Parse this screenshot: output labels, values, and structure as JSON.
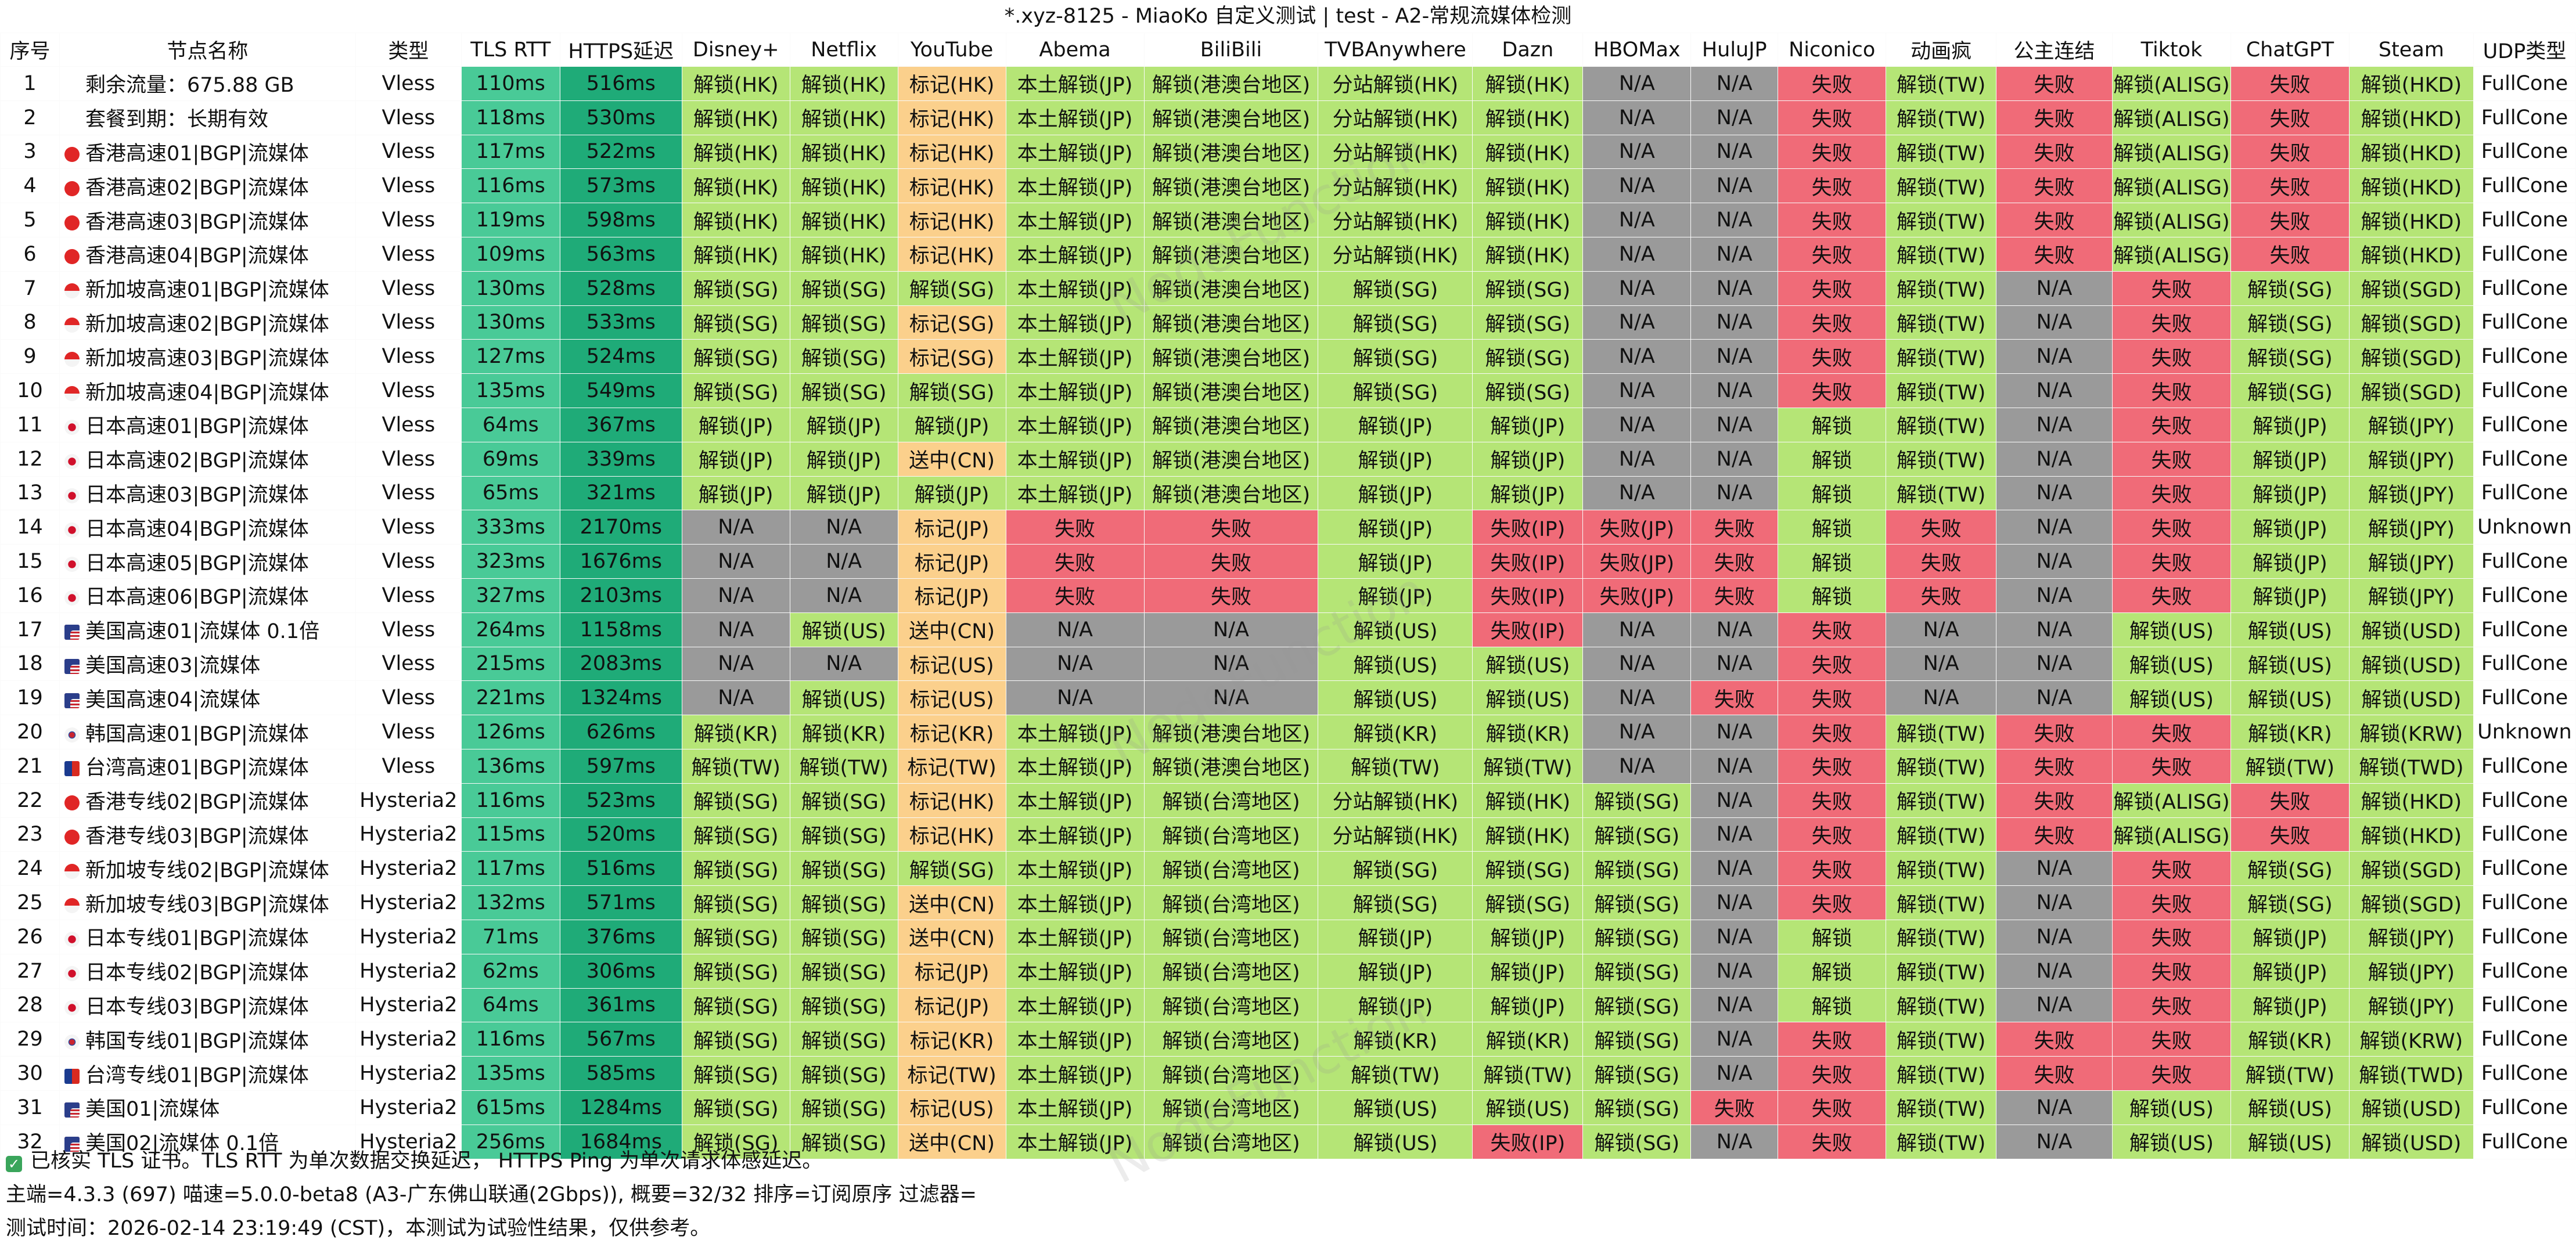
{
  "window": {
    "title": "*.xyz-8125 - MiaoKo 自定义测试 | test - A2-常规流媒体检测"
  },
  "colors": {
    "green": "#b5e576",
    "red": "#f06b78",
    "gray": "#9a9a9a",
    "orange": "#fbd08c",
    "white": "#ffffff",
    "rtt": "#49ca97",
    "https": "#1fab78"
  },
  "table": {
    "columns": [
      "序号",
      "节点名称",
      "类型",
      "TLS RTT",
      "HTTPS延迟",
      "Disney+",
      "Netflix",
      "YouTube",
      "Abema",
      "BiliBili",
      "TVBAnywhere",
      "Dazn",
      "HBOMax",
      "HuluJP",
      "Niconico",
      "动画疯",
      "公主连结",
      "Tiktok",
      "ChatGPT",
      "Steam",
      "UDP类型"
    ],
    "rows": [
      {
        "id": "1",
        "flag": "",
        "name": "剩余流量：675.88 GB",
        "type": "Vless",
        "rtt": "110ms",
        "https": "516ms",
        "cells": [
          "解锁(HK)",
          "解锁(HK)",
          "标记(HK)",
          "本土解锁(JP)",
          "解锁(港澳台地区)",
          "分站解锁(HK)",
          "解锁(HK)",
          "N/A",
          "N/A",
          "失败",
          "解锁(TW)",
          "失败",
          "解锁(ALISG)",
          "失败",
          "解锁(HKD)",
          "FullCone"
        ]
      },
      {
        "id": "2",
        "flag": "",
        "name": "套餐到期：长期有效",
        "type": "Vless",
        "rtt": "118ms",
        "https": "530ms",
        "cells": [
          "解锁(HK)",
          "解锁(HK)",
          "标记(HK)",
          "本土解锁(JP)",
          "解锁(港澳台地区)",
          "分站解锁(HK)",
          "解锁(HK)",
          "N/A",
          "N/A",
          "失败",
          "解锁(TW)",
          "失败",
          "解锁(ALISG)",
          "失败",
          "解锁(HKD)",
          "FullCone"
        ]
      },
      {
        "id": "3",
        "flag": "hk",
        "name": "香港高速01|BGP|流媒体",
        "type": "Vless",
        "rtt": "117ms",
        "https": "522ms",
        "cells": [
          "解锁(HK)",
          "解锁(HK)",
          "标记(HK)",
          "本土解锁(JP)",
          "解锁(港澳台地区)",
          "分站解锁(HK)",
          "解锁(HK)",
          "N/A",
          "N/A",
          "失败",
          "解锁(TW)",
          "失败",
          "解锁(ALISG)",
          "失败",
          "解锁(HKD)",
          "FullCone"
        ]
      },
      {
        "id": "4",
        "flag": "hk",
        "name": "香港高速02|BGP|流媒体",
        "type": "Vless",
        "rtt": "116ms",
        "https": "573ms",
        "cells": [
          "解锁(HK)",
          "解锁(HK)",
          "标记(HK)",
          "本土解锁(JP)",
          "解锁(港澳台地区)",
          "分站解锁(HK)",
          "解锁(HK)",
          "N/A",
          "N/A",
          "失败",
          "解锁(TW)",
          "失败",
          "解锁(ALISG)",
          "失败",
          "解锁(HKD)",
          "FullCone"
        ]
      },
      {
        "id": "5",
        "flag": "hk",
        "name": "香港高速03|BGP|流媒体",
        "type": "Vless",
        "rtt": "119ms",
        "https": "598ms",
        "cells": [
          "解锁(HK)",
          "解锁(HK)",
          "标记(HK)",
          "本土解锁(JP)",
          "解锁(港澳台地区)",
          "分站解锁(HK)",
          "解锁(HK)",
          "N/A",
          "N/A",
          "失败",
          "解锁(TW)",
          "失败",
          "解锁(ALISG)",
          "失败",
          "解锁(HKD)",
          "FullCone"
        ]
      },
      {
        "id": "6",
        "flag": "hk",
        "name": "香港高速04|BGP|流媒体",
        "type": "Vless",
        "rtt": "109ms",
        "https": "563ms",
        "cells": [
          "解锁(HK)",
          "解锁(HK)",
          "标记(HK)",
          "本土解锁(JP)",
          "解锁(港澳台地区)",
          "分站解锁(HK)",
          "解锁(HK)",
          "N/A",
          "N/A",
          "失败",
          "解锁(TW)",
          "失败",
          "解锁(ALISG)",
          "失败",
          "解锁(HKD)",
          "FullCone"
        ]
      },
      {
        "id": "7",
        "flag": "sg",
        "name": "新加坡高速01|BGP|流媒体",
        "type": "Vless",
        "rtt": "130ms",
        "https": "528ms",
        "cells": [
          "解锁(SG)",
          "解锁(SG)",
          "解锁(SG)",
          "本土解锁(JP)",
          "解锁(港澳台地区)",
          "解锁(SG)",
          "解锁(SG)",
          "N/A",
          "N/A",
          "失败",
          "解锁(TW)",
          "N/A",
          "失败",
          "解锁(SG)",
          "解锁(SGD)",
          "FullCone"
        ]
      },
      {
        "id": "8",
        "flag": "sg",
        "name": "新加坡高速02|BGP|流媒体",
        "type": "Vless",
        "rtt": "130ms",
        "https": "533ms",
        "cells": [
          "解锁(SG)",
          "解锁(SG)",
          "标记(SG)",
          "本土解锁(JP)",
          "解锁(港澳台地区)",
          "解锁(SG)",
          "解锁(SG)",
          "N/A",
          "N/A",
          "失败",
          "解锁(TW)",
          "N/A",
          "失败",
          "解锁(SG)",
          "解锁(SGD)",
          "FullCone"
        ]
      },
      {
        "id": "9",
        "flag": "sg",
        "name": "新加坡高速03|BGP|流媒体",
        "type": "Vless",
        "rtt": "127ms",
        "https": "524ms",
        "cells": [
          "解锁(SG)",
          "解锁(SG)",
          "标记(SG)",
          "本土解锁(JP)",
          "解锁(港澳台地区)",
          "解锁(SG)",
          "解锁(SG)",
          "N/A",
          "N/A",
          "失败",
          "解锁(TW)",
          "N/A",
          "失败",
          "解锁(SG)",
          "解锁(SGD)",
          "FullCone"
        ]
      },
      {
        "id": "10",
        "flag": "sg",
        "name": "新加坡高速04|BGP|流媒体",
        "type": "Vless",
        "rtt": "135ms",
        "https": "549ms",
        "cells": [
          "解锁(SG)",
          "解锁(SG)",
          "解锁(SG)",
          "本土解锁(JP)",
          "解锁(港澳台地区)",
          "解锁(SG)",
          "解锁(SG)",
          "N/A",
          "N/A",
          "失败",
          "解锁(TW)",
          "N/A",
          "失败",
          "解锁(SG)",
          "解锁(SGD)",
          "FullCone"
        ]
      },
      {
        "id": "11",
        "flag": "jp",
        "name": "日本高速01|BGP|流媒体",
        "type": "Vless",
        "rtt": "64ms",
        "https": "367ms",
        "cells": [
          "解锁(JP)",
          "解锁(JP)",
          "解锁(JP)",
          "本土解锁(JP)",
          "解锁(港澳台地区)",
          "解锁(JP)",
          "解锁(JP)",
          "N/A",
          "N/A",
          "解锁",
          "解锁(TW)",
          "N/A",
          "失败",
          "解锁(JP)",
          "解锁(JPY)",
          "FullCone"
        ]
      },
      {
        "id": "12",
        "flag": "jp",
        "name": "日本高速02|BGP|流媒体",
        "type": "Vless",
        "rtt": "69ms",
        "https": "339ms",
        "cells": [
          "解锁(JP)",
          "解锁(JP)",
          "送中(CN)",
          "本土解锁(JP)",
          "解锁(港澳台地区)",
          "解锁(JP)",
          "解锁(JP)",
          "N/A",
          "N/A",
          "解锁",
          "解锁(TW)",
          "N/A",
          "失败",
          "解锁(JP)",
          "解锁(JPY)",
          "FullCone"
        ]
      },
      {
        "id": "13",
        "flag": "jp",
        "name": "日本高速03|BGP|流媒体",
        "type": "Vless",
        "rtt": "65ms",
        "https": "321ms",
        "cells": [
          "解锁(JP)",
          "解锁(JP)",
          "解锁(JP)",
          "本土解锁(JP)",
          "解锁(港澳台地区)",
          "解锁(JP)",
          "解锁(JP)",
          "N/A",
          "N/A",
          "解锁",
          "解锁(TW)",
          "N/A",
          "失败",
          "解锁(JP)",
          "解锁(JPY)",
          "FullCone"
        ]
      },
      {
        "id": "14",
        "flag": "jp",
        "name": "日本高速04|BGP|流媒体",
        "type": "Vless",
        "rtt": "333ms",
        "https": "2170ms",
        "cells": [
          "N/A",
          "N/A",
          "标记(JP)",
          "失败",
          "失败",
          "解锁(JP)",
          "失败(IP)",
          "失败(JP)",
          "失败",
          "解锁",
          "失败",
          "N/A",
          "失败",
          "解锁(JP)",
          "解锁(JPY)",
          "Unknown"
        ]
      },
      {
        "id": "15",
        "flag": "jp",
        "name": "日本高速05|BGP|流媒体",
        "type": "Vless",
        "rtt": "323ms",
        "https": "1676ms",
        "cells": [
          "N/A",
          "N/A",
          "标记(JP)",
          "失败",
          "失败",
          "解锁(JP)",
          "失败(IP)",
          "失败(JP)",
          "失败",
          "解锁",
          "失败",
          "N/A",
          "失败",
          "解锁(JP)",
          "解锁(JPY)",
          "FullCone"
        ]
      },
      {
        "id": "16",
        "flag": "jp",
        "name": "日本高速06|BGP|流媒体",
        "type": "Vless",
        "rtt": "327ms",
        "https": "2103ms",
        "cells": [
          "N/A",
          "N/A",
          "标记(JP)",
          "失败",
          "失败",
          "解锁(JP)",
          "失败(IP)",
          "失败(JP)",
          "失败",
          "解锁",
          "失败",
          "N/A",
          "失败",
          "解锁(JP)",
          "解锁(JPY)",
          "FullCone"
        ]
      },
      {
        "id": "17",
        "flag": "us",
        "name": "美国高速01|流媒体 0.1倍",
        "type": "Vless",
        "rtt": "264ms",
        "https": "1158ms",
        "cells": [
          "N/A",
          "解锁(US)",
          "送中(CN)",
          "N/A",
          "N/A",
          "解锁(US)",
          "失败(IP)",
          "N/A",
          "N/A",
          "失败",
          "N/A",
          "N/A",
          "解锁(US)",
          "解锁(US)",
          "解锁(USD)",
          "FullCone"
        ]
      },
      {
        "id": "18",
        "flag": "us",
        "name": "美国高速03|流媒体",
        "type": "Vless",
        "rtt": "215ms",
        "https": "2083ms",
        "cells": [
          "N/A",
          "N/A",
          "标记(US)",
          "N/A",
          "N/A",
          "解锁(US)",
          "解锁(US)",
          "N/A",
          "N/A",
          "失败",
          "N/A",
          "N/A",
          "解锁(US)",
          "解锁(US)",
          "解锁(USD)",
          "FullCone"
        ]
      },
      {
        "id": "19",
        "flag": "us",
        "name": "美国高速04|流媒体",
        "type": "Vless",
        "rtt": "221ms",
        "https": "1324ms",
        "cells": [
          "N/A",
          "解锁(US)",
          "标记(US)",
          "N/A",
          "N/A",
          "解锁(US)",
          "解锁(US)",
          "N/A",
          "失败",
          "失败",
          "N/A",
          "N/A",
          "解锁(US)",
          "解锁(US)",
          "解锁(USD)",
          "FullCone"
        ]
      },
      {
        "id": "20",
        "flag": "kr",
        "name": "韩国高速01|BGP|流媒体",
        "type": "Vless",
        "rtt": "126ms",
        "https": "626ms",
        "cells": [
          "解锁(KR)",
          "解锁(KR)",
          "标记(KR)",
          "本土解锁(JP)",
          "解锁(港澳台地区)",
          "解锁(KR)",
          "解锁(KR)",
          "N/A",
          "N/A",
          "失败",
          "解锁(TW)",
          "失败",
          "失败",
          "解锁(KR)",
          "解锁(KRW)",
          "Unknown"
        ]
      },
      {
        "id": "21",
        "flag": "tw",
        "name": "台湾高速01|BGP|流媒体",
        "type": "Vless",
        "rtt": "136ms",
        "https": "597ms",
        "cells": [
          "解锁(TW)",
          "解锁(TW)",
          "标记(TW)",
          "本土解锁(JP)",
          "解锁(港澳台地区)",
          "解锁(TW)",
          "解锁(TW)",
          "N/A",
          "N/A",
          "失败",
          "解锁(TW)",
          "失败",
          "失败",
          "解锁(TW)",
          "解锁(TWD)",
          "FullCone"
        ]
      },
      {
        "id": "22",
        "flag": "hk",
        "name": "香港专线02|BGP|流媒体",
        "type": "Hysteria2",
        "rtt": "116ms",
        "https": "523ms",
        "cells": [
          "解锁(SG)",
          "解锁(SG)",
          "标记(HK)",
          "本土解锁(JP)",
          "解锁(台湾地区)",
          "分站解锁(HK)",
          "解锁(HK)",
          "解锁(SG)",
          "N/A",
          "失败",
          "解锁(TW)",
          "失败",
          "解锁(ALISG)",
          "失败",
          "解锁(HKD)",
          "FullCone"
        ]
      },
      {
        "id": "23",
        "flag": "hk",
        "name": "香港专线03|BGP|流媒体",
        "type": "Hysteria2",
        "rtt": "115ms",
        "https": "520ms",
        "cells": [
          "解锁(SG)",
          "解锁(SG)",
          "标记(HK)",
          "本土解锁(JP)",
          "解锁(台湾地区)",
          "分站解锁(HK)",
          "解锁(HK)",
          "解锁(SG)",
          "N/A",
          "失败",
          "解锁(TW)",
          "失败",
          "解锁(ALISG)",
          "失败",
          "解锁(HKD)",
          "FullCone"
        ]
      },
      {
        "id": "24",
        "flag": "sg",
        "name": "新加坡专线02|BGP|流媒体",
        "type": "Hysteria2",
        "rtt": "117ms",
        "https": "516ms",
        "cells": [
          "解锁(SG)",
          "解锁(SG)",
          "解锁(SG)",
          "本土解锁(JP)",
          "解锁(台湾地区)",
          "解锁(SG)",
          "解锁(SG)",
          "解锁(SG)",
          "N/A",
          "失败",
          "解锁(TW)",
          "N/A",
          "失败",
          "解锁(SG)",
          "解锁(SGD)",
          "FullCone"
        ]
      },
      {
        "id": "25",
        "flag": "sg",
        "name": "新加坡专线03|BGP|流媒体",
        "type": "Hysteria2",
        "rtt": "132ms",
        "https": "571ms",
        "cells": [
          "解锁(SG)",
          "解锁(SG)",
          "送中(CN)",
          "本土解锁(JP)",
          "解锁(台湾地区)",
          "解锁(SG)",
          "解锁(SG)",
          "解锁(SG)",
          "N/A",
          "失败",
          "解锁(TW)",
          "N/A",
          "失败",
          "解锁(SG)",
          "解锁(SGD)",
          "FullCone"
        ]
      },
      {
        "id": "26",
        "flag": "jp",
        "name": "日本专线01|BGP|流媒体",
        "type": "Hysteria2",
        "rtt": "71ms",
        "https": "376ms",
        "cells": [
          "解锁(SG)",
          "解锁(SG)",
          "送中(CN)",
          "本土解锁(JP)",
          "解锁(台湾地区)",
          "解锁(JP)",
          "解锁(JP)",
          "解锁(SG)",
          "N/A",
          "解锁",
          "解锁(TW)",
          "N/A",
          "失败",
          "解锁(JP)",
          "解锁(JPY)",
          "FullCone"
        ]
      },
      {
        "id": "27",
        "flag": "jp",
        "name": "日本专线02|BGP|流媒体",
        "type": "Hysteria2",
        "rtt": "62ms",
        "https": "306ms",
        "cells": [
          "解锁(SG)",
          "解锁(SG)",
          "标记(JP)",
          "本土解锁(JP)",
          "解锁(台湾地区)",
          "解锁(JP)",
          "解锁(JP)",
          "解锁(SG)",
          "N/A",
          "解锁",
          "解锁(TW)",
          "N/A",
          "失败",
          "解锁(JP)",
          "解锁(JPY)",
          "FullCone"
        ]
      },
      {
        "id": "28",
        "flag": "jp",
        "name": "日本专线03|BGP|流媒体",
        "type": "Hysteria2",
        "rtt": "64ms",
        "https": "361ms",
        "cells": [
          "解锁(SG)",
          "解锁(SG)",
          "标记(JP)",
          "本土解锁(JP)",
          "解锁(台湾地区)",
          "解锁(JP)",
          "解锁(JP)",
          "解锁(SG)",
          "N/A",
          "解锁",
          "解锁(TW)",
          "N/A",
          "失败",
          "解锁(JP)",
          "解锁(JPY)",
          "FullCone"
        ]
      },
      {
        "id": "29",
        "flag": "kr",
        "name": "韩国专线01|BGP|流媒体",
        "type": "Hysteria2",
        "rtt": "116ms",
        "https": "567ms",
        "cells": [
          "解锁(SG)",
          "解锁(SG)",
          "标记(KR)",
          "本土解锁(JP)",
          "解锁(台湾地区)",
          "解锁(KR)",
          "解锁(KR)",
          "解锁(SG)",
          "N/A",
          "失败",
          "解锁(TW)",
          "失败",
          "失败",
          "解锁(KR)",
          "解锁(KRW)",
          "FullCone"
        ]
      },
      {
        "id": "30",
        "flag": "tw",
        "name": "台湾专线01|BGP|流媒体",
        "type": "Hysteria2",
        "rtt": "135ms",
        "https": "585ms",
        "cells": [
          "解锁(SG)",
          "解锁(SG)",
          "标记(TW)",
          "本土解锁(JP)",
          "解锁(台湾地区)",
          "解锁(TW)",
          "解锁(TW)",
          "解锁(SG)",
          "N/A",
          "失败",
          "解锁(TW)",
          "失败",
          "失败",
          "解锁(TW)",
          "解锁(TWD)",
          "FullCone"
        ]
      },
      {
        "id": "31",
        "flag": "us",
        "name": "美国01|流媒体",
        "type": "Hysteria2",
        "rtt": "615ms",
        "https": "1284ms",
        "cells": [
          "解锁(SG)",
          "解锁(SG)",
          "标记(US)",
          "本土解锁(JP)",
          "解锁(台湾地区)",
          "解锁(US)",
          "解锁(US)",
          "解锁(SG)",
          "失败",
          "失败",
          "解锁(TW)",
          "N/A",
          "解锁(US)",
          "解锁(US)",
          "解锁(USD)",
          "FullCone"
        ]
      },
      {
        "id": "32",
        "flag": "us",
        "name": "美国02|流媒体 0.1倍",
        "type": "Hysteria2",
        "rtt": "256ms",
        "https": "1684ms",
        "cells": [
          "解锁(SG)",
          "解锁(SG)",
          "送中(CN)",
          "本土解锁(JP)",
          "解锁(台湾地区)",
          "解锁(US)",
          "失败(IP)",
          "解锁(SG)",
          "N/A",
          "失败",
          "解锁(TW)",
          "N/A",
          "解锁(US)",
          "解锁(US)",
          "解锁(USD)",
          "FullCone"
        ]
      }
    ]
  },
  "footer": {
    "line1": "已核实 TLS 证书。TLS RTT 为单次数据交换延迟， HTTPS Ping 为单次请求体感延迟。",
    "line2": "主端=4.3.3 (697) 喵速=5.0.0-beta8 (A3-广东佛山联通(2Gbps)), 概要=32/32 排序=订阅原序 过滤器=",
    "line3": "测试时间：2026-02-14 23:19:49 (CST)，本测试为试验性结果，仅供参考。"
  },
  "watermark": "NodeFunction"
}
